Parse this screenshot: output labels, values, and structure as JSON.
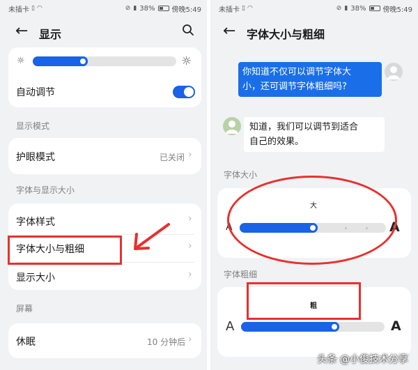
{
  "status_bar": {
    "carrier": "未插卡",
    "battery": "38%",
    "time": "傍晚5:49"
  },
  "left": {
    "title": "显示",
    "auto_adjust": "自动调节",
    "brightness_level": 0.35,
    "sections": {
      "display_mode": "显示模式",
      "font_display": "字体与显示大小",
      "screen": "屏幕"
    },
    "eye_care": {
      "label": "护眼模式",
      "value": "已关闭"
    },
    "font_style": "字体样式",
    "font_size_weight": "字体大小与粗细",
    "display_size": "显示大小",
    "sleep": {
      "label": "休眠",
      "value": "10 分钟后"
    }
  },
  "right": {
    "title": "字体大小与粗细",
    "question": [
      "你知道不仅可以调节字体大",
      "小，还可调节字体粗细吗?"
    ],
    "answer": [
      "知道，我们可以调节到适合",
      "自己的效果。"
    ],
    "size_label": "字体大小",
    "size_preview": "大",
    "size_level": 0.5,
    "weight_label": "字体粗细",
    "weight_preview": "粗",
    "weight_level": 0.65,
    "letter_small": "A",
    "letter_large": "A"
  },
  "watermark": "头条 @小俊技术分享",
  "colors": {
    "accent": "#1a62e6",
    "highlight": "#e8302e",
    "bubble": "#1a6fe8"
  }
}
